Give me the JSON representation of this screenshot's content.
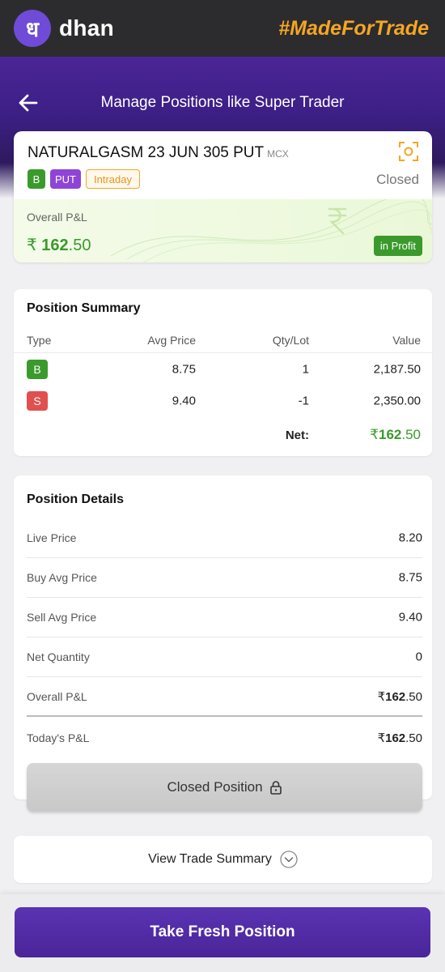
{
  "app": {
    "logo_glyph": "ध",
    "brand": "dhan",
    "tagline": "#MadeForTrade"
  },
  "header": {
    "title": "Manage Positions like Super Trader"
  },
  "instrument": {
    "name": "NATURALGASM 23 JUN 305 PUT",
    "exchange": "MCX",
    "badges": {
      "side": "B",
      "option": "PUT",
      "product": "Intraday"
    },
    "status": "Closed",
    "pl_label": "Overall P&L",
    "pl_currency": "₹",
    "pl_int": "162",
    "pl_dec": ".50",
    "profit_badge": "in Profit"
  },
  "summary": {
    "title": "Position Summary",
    "columns": [
      "Type",
      "Avg Price",
      "Qty/Lot",
      "Value"
    ],
    "rows": [
      {
        "type": "B",
        "avg": "8.75",
        "qty": "1",
        "value": "2,187.50"
      },
      {
        "type": "S",
        "avg": "9.40",
        "qty": "-1",
        "value": "2,350.00"
      }
    ],
    "net_label": "Net:",
    "net_currency": "₹",
    "net_int": "162",
    "net_dec": ".50"
  },
  "details": {
    "title": "Position Details",
    "live_price_label": "Live Price",
    "live_price": "8.20",
    "buy_avg_label": "Buy Avg Price",
    "buy_avg": "8.75",
    "sell_avg_label": "Sell Avg Price",
    "sell_avg": "9.40",
    "net_qty_label": "Net Quantity",
    "net_qty": "0",
    "overall_pl_label": "Overall P&L",
    "overall_pl_currency": "₹",
    "overall_pl_int": "162",
    "overall_pl_dec": ".50",
    "today_pl_label": "Today's P&L",
    "today_pl_currency": "₹",
    "today_pl_int": "162",
    "today_pl_dec": ".50",
    "closed_button": "Closed Position"
  },
  "trade_summary_label": "View Trade Summary",
  "fresh_button": "Take Fresh Position",
  "colors": {
    "primary": "#4a2598",
    "accent": "#f5a623",
    "profit": "#3a9a2c",
    "sell": "#e0504f"
  }
}
